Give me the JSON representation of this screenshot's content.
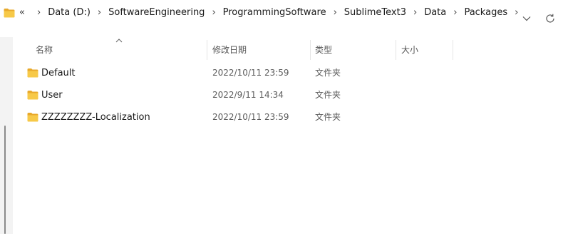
{
  "address_bar": {
    "overflow": "«",
    "crumbs": [
      "Data (D:)",
      "SoftwareEngineering",
      "ProgrammingSoftware",
      "SublimeText3",
      "Data",
      "Packages"
    ],
    "separator": "›"
  },
  "columns": {
    "name": "名称",
    "modified": "修改日期",
    "type": "类型",
    "size": "大小"
  },
  "files": [
    {
      "name": "Default",
      "modified": "2022/10/11 23:59",
      "type": "文件夹",
      "size": ""
    },
    {
      "name": "User",
      "modified": "2022/9/11 14:34",
      "type": "文件夹",
      "size": ""
    },
    {
      "name": "ZZZZZZZZ-Localization",
      "modified": "2022/10/11 23:59",
      "type": "文件夹",
      "size": ""
    }
  ],
  "colors": {
    "folder_fill": "#f7c948",
    "folder_tab": "#e8a92b",
    "folder_front": "#fbd86b"
  },
  "icons": {
    "folder": "folder-icon",
    "dropdown": "chevron-down-icon",
    "refresh": "refresh-icon",
    "sort": "sort-up-icon"
  }
}
